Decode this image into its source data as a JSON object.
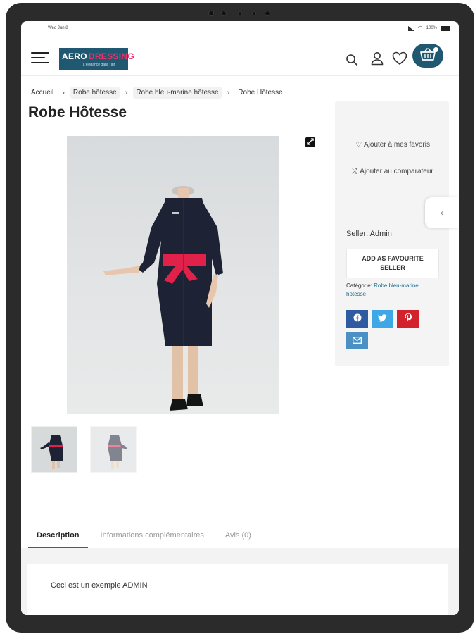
{
  "status_bar": {
    "left_text": "Wed Jun 8",
    "battery_text": "100%"
  },
  "header": {
    "logo": {
      "word1": "AERO",
      "word2": "DRESSING",
      "tagline": "L'élégance dans l'air"
    }
  },
  "breadcrumb": [
    "Accueil",
    "Robe hôtesse",
    "Robe bleu-marine hôtesse",
    "Robe Hôtesse"
  ],
  "product": {
    "title": "Robe Hôtesse"
  },
  "sidebar": {
    "add_favorites": "Ajouter à mes favoris",
    "add_compare": "Ajouter au comparateur",
    "seller": "Seller: Admin",
    "favourite_seller_button": "ADD AS FAVOURITE SELLER",
    "category_label": "Catégorie:",
    "category_value": "Robe bleu-marine hôtesse",
    "share_icons": [
      "facebook-icon",
      "twitter-icon",
      "pinterest-icon",
      "email-icon"
    ]
  },
  "tabs": [
    {
      "label": "Description",
      "active": true
    },
    {
      "label": "Informations complémentaires",
      "active": false
    },
    {
      "label": "Avis (0)",
      "active": false
    }
  ],
  "tab_content": "Ceci est un exemple ADMIN",
  "colors": {
    "brand": "#1f5870",
    "brand_pink": "#e9346a",
    "link": "#1f6d8c",
    "facebook": "#2d5aa0",
    "twitter": "#3ea7e5",
    "pinterest": "#d2222b",
    "email": "#4a90c4",
    "dress": "#1d2235",
    "sash": "#e0214a"
  }
}
